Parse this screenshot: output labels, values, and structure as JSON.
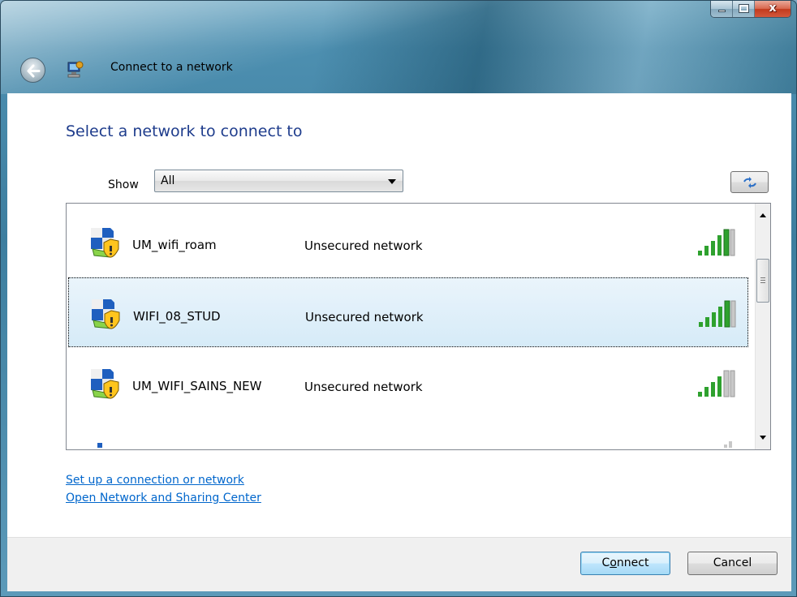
{
  "window": {
    "title": "Connect to a network",
    "caption": {
      "minimize": "minimize",
      "maximize": "maximize",
      "close": "x"
    }
  },
  "content": {
    "heading": "Select a network to connect to",
    "show_label": "Show",
    "show_value": "All"
  },
  "networks": [
    {
      "name": "UM_wifi_roam",
      "status": "Unsecured network",
      "selected": false,
      "icon": "wireless-network-shield-icon",
      "signal_bars": 5
    },
    {
      "name": "WIFI_08_STUD",
      "status": "Unsecured network",
      "selected": true,
      "icon": "wireless-network-shield-icon",
      "signal_bars": 5
    },
    {
      "name": "UM_WIFI_SAINS_NEW",
      "status": "Unsecured network",
      "selected": false,
      "icon": "wireless-network-shield-icon",
      "signal_bars": 4
    }
  ],
  "links": {
    "setup": "Set up a connection or network",
    "sharing_center": "Open Network and Sharing Center"
  },
  "buttons": {
    "connect_pre": "C",
    "connect_accel": "o",
    "connect_post": "nnect",
    "cancel": "Cancel"
  },
  "colors": {
    "heading": "#1e3c8c",
    "link": "#0066cc",
    "signal": "#2ea12e",
    "selection": "#d6ebf8"
  }
}
